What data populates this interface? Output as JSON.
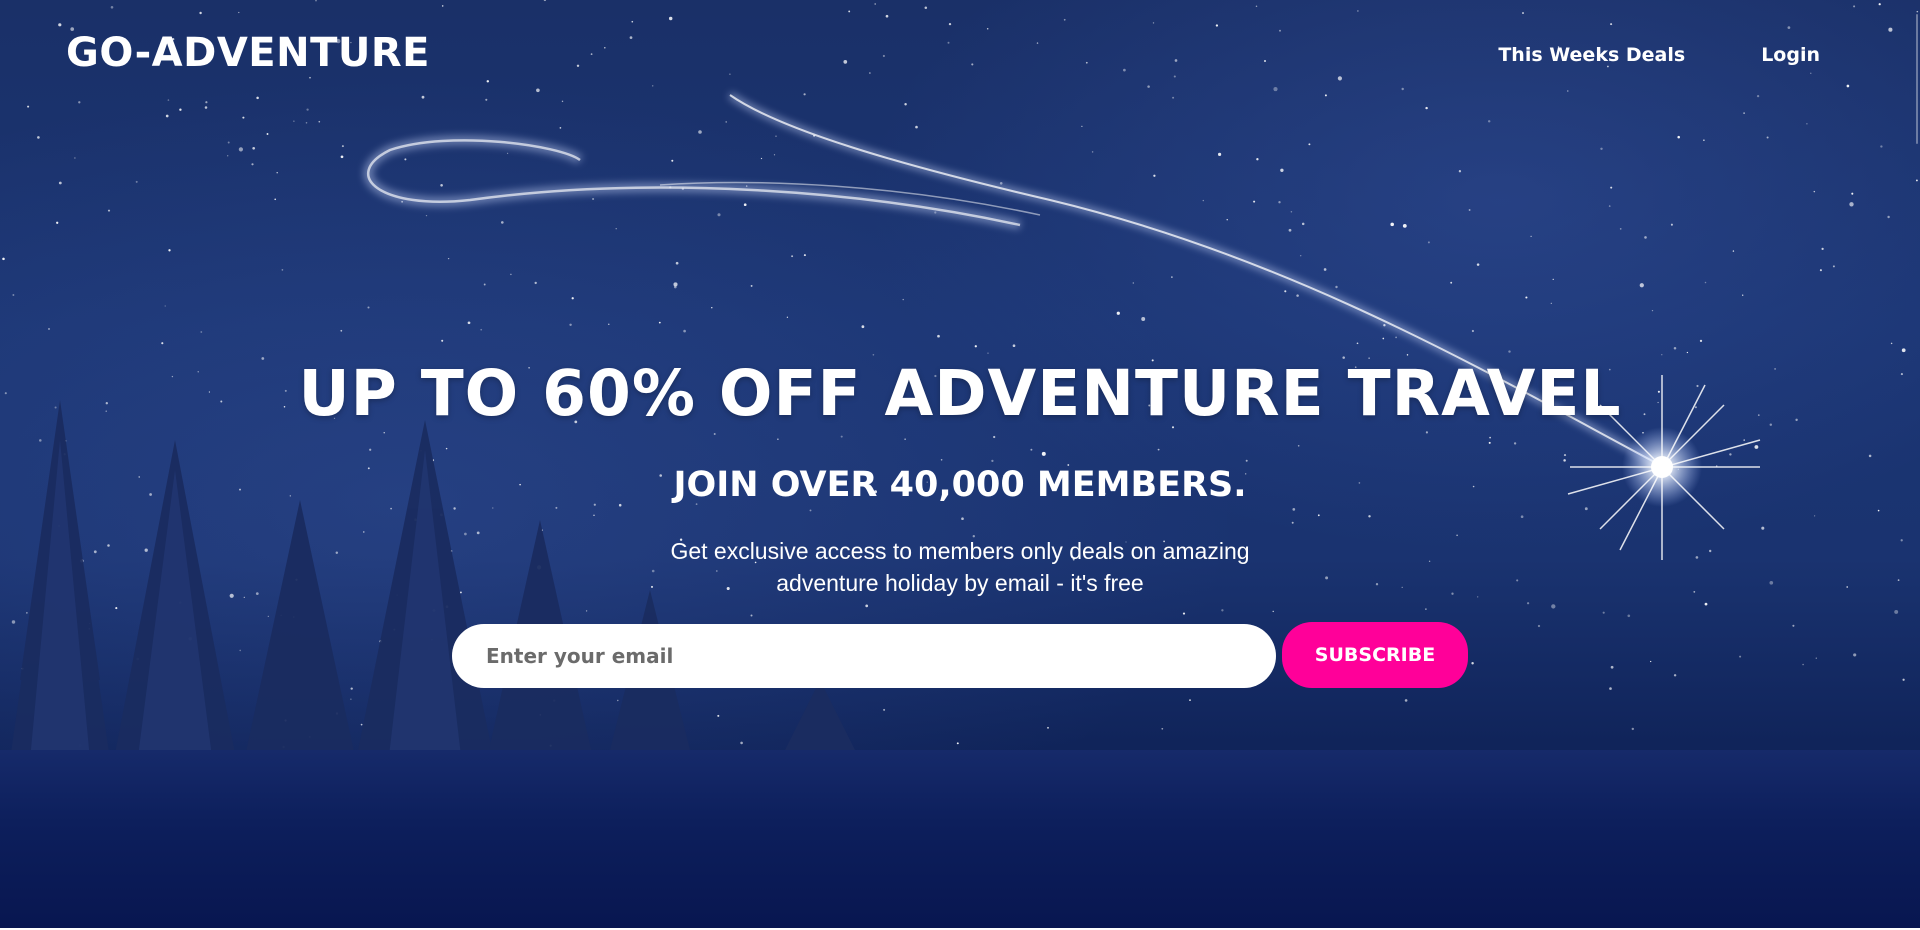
{
  "brand": {
    "logo_text": "GO-ADVENTURE"
  },
  "nav": {
    "items": [
      {
        "label": "This Weeks Deals"
      },
      {
        "label": "Login"
      }
    ]
  },
  "hero": {
    "headline": "UP TO 60% OFF ADVENTURE TRAVEL",
    "subheadline": "JOIN OVER 40,000 MEMBERS.",
    "description": "Get exclusive access to members only deals on amazing adventure holiday by email - it's free"
  },
  "signup": {
    "email_placeholder": "Enter your email",
    "email_value": "",
    "subscribe_label": "SUBSCRIBE"
  },
  "icons": {
    "background": "night-sky-image",
    "star": "shooting-star-icon"
  },
  "colors": {
    "accent": "#ff0099",
    "sky": "#1b3573",
    "text": "#ffffff"
  }
}
